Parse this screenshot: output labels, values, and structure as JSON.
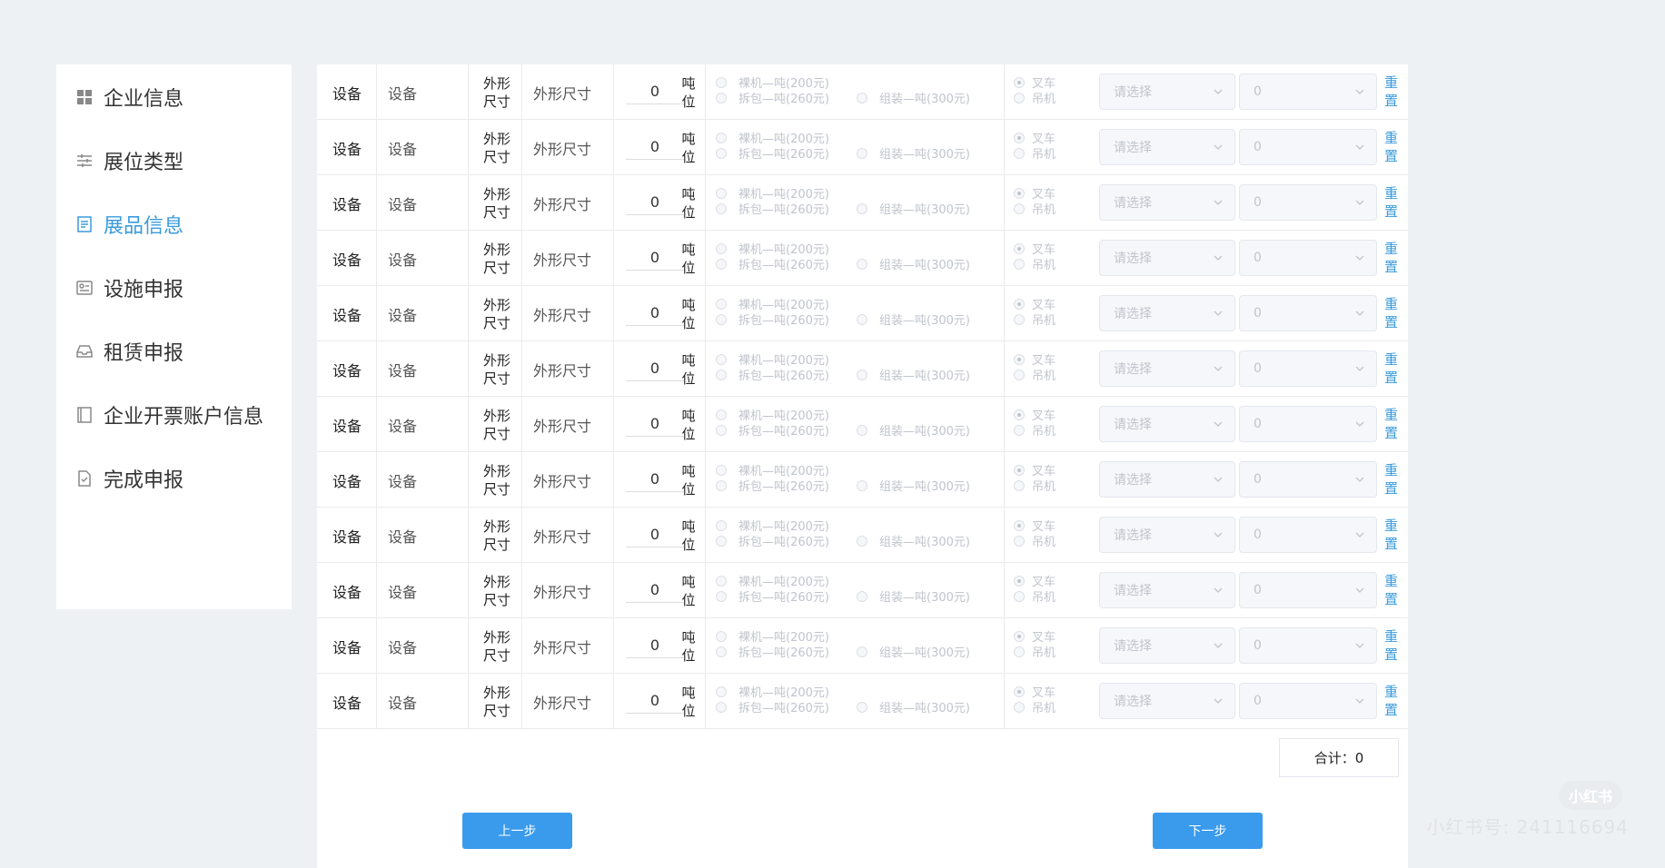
{
  "sidebar": {
    "items": [
      {
        "label": "企业信息",
        "icon": "grid-icon",
        "active": false
      },
      {
        "label": "展位类型",
        "icon": "sliders-icon",
        "active": false
      },
      {
        "label": "展品信息",
        "icon": "document-icon",
        "active": true
      },
      {
        "label": "设施申报",
        "icon": "facility-icon",
        "active": false
      },
      {
        "label": "租赁申报",
        "icon": "inbox-icon",
        "active": false
      },
      {
        "label": "企业开票账户信息",
        "icon": "book-icon",
        "active": false
      },
      {
        "label": "完成申报",
        "icon": "file-check-icon",
        "active": false
      }
    ]
  },
  "table": {
    "rows": [
      {
        "label1": "设备",
        "val1": "设备",
        "label2": "外形尺寸",
        "val2": "外形尺寸",
        "tons": "0",
        "unit": "吨位",
        "opt_a": "裸机—吨(200元)",
        "opt_b": "拆包—吨(260元)",
        "opt_c": "组装—吨(300元)",
        "opt_d": "叉车",
        "opt_e": "吊机",
        "select1": "请选择",
        "select2": "0",
        "reset": "重置"
      },
      {
        "label1": "设备",
        "val1": "设备",
        "label2": "外形尺寸",
        "val2": "外形尺寸",
        "tons": "0",
        "unit": "吨位",
        "opt_a": "裸机—吨(200元)",
        "opt_b": "拆包—吨(260元)",
        "opt_c": "组装—吨(300元)",
        "opt_d": "叉车",
        "opt_e": "吊机",
        "select1": "请选择",
        "select2": "0",
        "reset": "重置"
      },
      {
        "label1": "设备",
        "val1": "设备",
        "label2": "外形尺寸",
        "val2": "外形尺寸",
        "tons": "0",
        "unit": "吨位",
        "opt_a": "裸机—吨(200元)",
        "opt_b": "拆包—吨(260元)",
        "opt_c": "组装—吨(300元)",
        "opt_d": "叉车",
        "opt_e": "吊机",
        "select1": "请选择",
        "select2": "0",
        "reset": "重置"
      },
      {
        "label1": "设备",
        "val1": "设备",
        "label2": "外形尺寸",
        "val2": "外形尺寸",
        "tons": "0",
        "unit": "吨位",
        "opt_a": "裸机—吨(200元)",
        "opt_b": "拆包—吨(260元)",
        "opt_c": "组装—吨(300元)",
        "opt_d": "叉车",
        "opt_e": "吊机",
        "select1": "请选择",
        "select2": "0",
        "reset": "重置"
      },
      {
        "label1": "设备",
        "val1": "设备",
        "label2": "外形尺寸",
        "val2": "外形尺寸",
        "tons": "0",
        "unit": "吨位",
        "opt_a": "裸机—吨(200元)",
        "opt_b": "拆包—吨(260元)",
        "opt_c": "组装—吨(300元)",
        "opt_d": "叉车",
        "opt_e": "吊机",
        "select1": "请选择",
        "select2": "0",
        "reset": "重置"
      },
      {
        "label1": "设备",
        "val1": "设备",
        "label2": "外形尺寸",
        "val2": "外形尺寸",
        "tons": "0",
        "unit": "吨位",
        "opt_a": "裸机—吨(200元)",
        "opt_b": "拆包—吨(260元)",
        "opt_c": "组装—吨(300元)",
        "opt_d": "叉车",
        "opt_e": "吊机",
        "select1": "请选择",
        "select2": "0",
        "reset": "重置"
      },
      {
        "label1": "设备",
        "val1": "设备",
        "label2": "外形尺寸",
        "val2": "外形尺寸",
        "tons": "0",
        "unit": "吨位",
        "opt_a": "裸机—吨(200元)",
        "opt_b": "拆包—吨(260元)",
        "opt_c": "组装—吨(300元)",
        "opt_d": "叉车",
        "opt_e": "吊机",
        "select1": "请选择",
        "select2": "0",
        "reset": "重置"
      },
      {
        "label1": "设备",
        "val1": "设备",
        "label2": "外形尺寸",
        "val2": "外形尺寸",
        "tons": "0",
        "unit": "吨位",
        "opt_a": "裸机—吨(200元)",
        "opt_b": "拆包—吨(260元)",
        "opt_c": "组装—吨(300元)",
        "opt_d": "叉车",
        "opt_e": "吊机",
        "select1": "请选择",
        "select2": "0",
        "reset": "重置"
      },
      {
        "label1": "设备",
        "val1": "设备",
        "label2": "外形尺寸",
        "val2": "外形尺寸",
        "tons": "0",
        "unit": "吨位",
        "opt_a": "裸机—吨(200元)",
        "opt_b": "拆包—吨(260元)",
        "opt_c": "组装—吨(300元)",
        "opt_d": "叉车",
        "opt_e": "吊机",
        "select1": "请选择",
        "select2": "0",
        "reset": "重置"
      },
      {
        "label1": "设备",
        "val1": "设备",
        "label2": "外形尺寸",
        "val2": "外形尺寸",
        "tons": "0",
        "unit": "吨位",
        "opt_a": "裸机—吨(200元)",
        "opt_b": "拆包—吨(260元)",
        "opt_c": "组装—吨(300元)",
        "opt_d": "叉车",
        "opt_e": "吊机",
        "select1": "请选择",
        "select2": "0",
        "reset": "重置"
      },
      {
        "label1": "设备",
        "val1": "设备",
        "label2": "外形尺寸",
        "val2": "外形尺寸",
        "tons": "0",
        "unit": "吨位",
        "opt_a": "裸机—吨(200元)",
        "opt_b": "拆包—吨(260元)",
        "opt_c": "组装—吨(300元)",
        "opt_d": "叉车",
        "opt_e": "吊机",
        "select1": "请选择",
        "select2": "0",
        "reset": "重置"
      },
      {
        "label1": "设备",
        "val1": "设备",
        "label2": "外形尺寸",
        "val2": "外形尺寸",
        "tons": "0",
        "unit": "吨位",
        "opt_a": "裸机—吨(200元)",
        "opt_b": "拆包—吨(260元)",
        "opt_c": "组装—吨(300元)",
        "opt_d": "叉车",
        "opt_e": "吊机",
        "select1": "请选择",
        "select2": "0",
        "reset": "重置"
      }
    ]
  },
  "total": {
    "label": "合计：",
    "value": "0"
  },
  "buttons": {
    "prev": "上一步",
    "next": "下一步"
  },
  "watermark": {
    "logo": "小红书",
    "text": "小红书号: 241116694"
  },
  "colors": {
    "accent": "#3a9bed",
    "active_nav": "#3a9bdc",
    "background": "#eef1f4"
  }
}
